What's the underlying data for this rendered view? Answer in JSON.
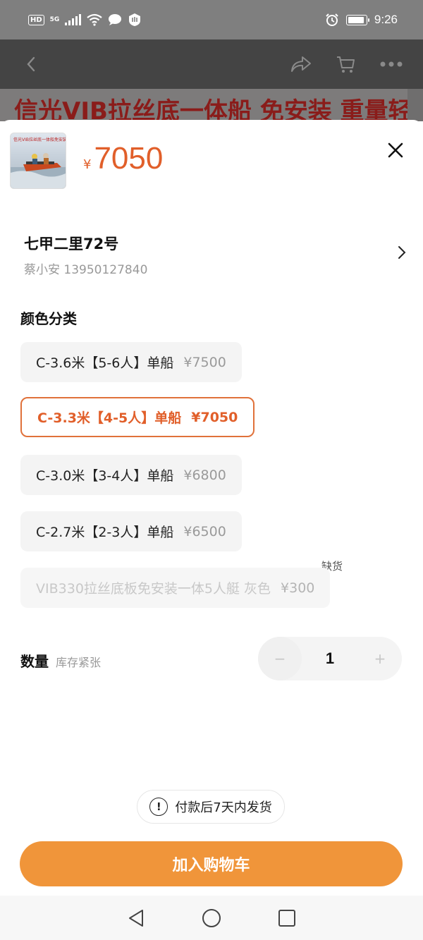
{
  "status_bar": {
    "hd": "HD",
    "network": "5G",
    "time": "9:26"
  },
  "top_banner": {
    "text": "信光VIB拉丝底一体船 免安装 重量轻"
  },
  "product": {
    "thumbnail_caption": "信光VIB拉丝底一体船免安装重量轻",
    "currency": "¥",
    "price": "7050"
  },
  "address": {
    "line": "七甲二里72号",
    "contact": "蔡小安 13950127840"
  },
  "color_section": {
    "title": "颜色分类",
    "options": [
      {
        "label": "C-3.6米【5-6人】单船",
        "price": "¥7500",
        "state": "normal"
      },
      {
        "label": "C-3.3米【4-5人】单船",
        "price": "¥7050",
        "state": "selected"
      },
      {
        "label": "C-3.0米【3-4人】单船",
        "price": "¥6800",
        "state": "normal"
      },
      {
        "label": "C-2.7米【2-3人】单船",
        "price": "¥6500",
        "state": "normal"
      },
      {
        "label": "VIB330拉丝底板免安装一体5人艇 灰色",
        "price": "¥300",
        "state": "disabled"
      }
    ],
    "out_of_stock_tag": "缺货"
  },
  "quantity": {
    "label": "数量",
    "stock_note": "库存紧张",
    "value": "1",
    "minus": "−",
    "plus": "+"
  },
  "shipping_note": "付款后7天内发货",
  "cta": {
    "label": "加入购物车"
  },
  "colors": {
    "accent": "#e15f2a",
    "cta_bg": "#f0953a",
    "dim": "#7f7f7f"
  }
}
